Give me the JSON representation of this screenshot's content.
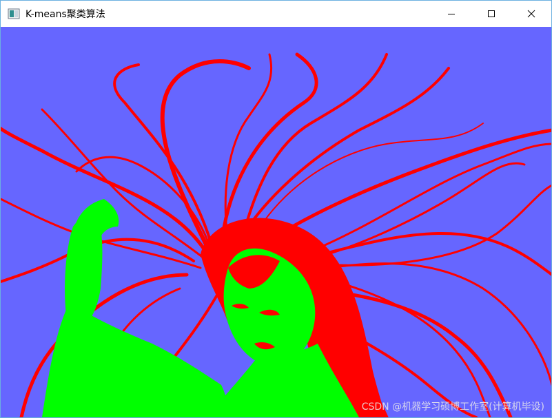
{
  "window": {
    "title": "K-means聚类算法",
    "app_icon": "window-app-icon",
    "controls": {
      "minimize": "minimize-icon",
      "maximize": "maximize-icon",
      "close": "close-icon"
    }
  },
  "image": {
    "description_icon": "segmented-image",
    "colors": {
      "background": "#6666ff",
      "hair": "#ff0000",
      "skin": "#00ff00"
    }
  },
  "watermark": {
    "text": "CSDN @机器学习硕博工作室(计算机毕设)"
  }
}
